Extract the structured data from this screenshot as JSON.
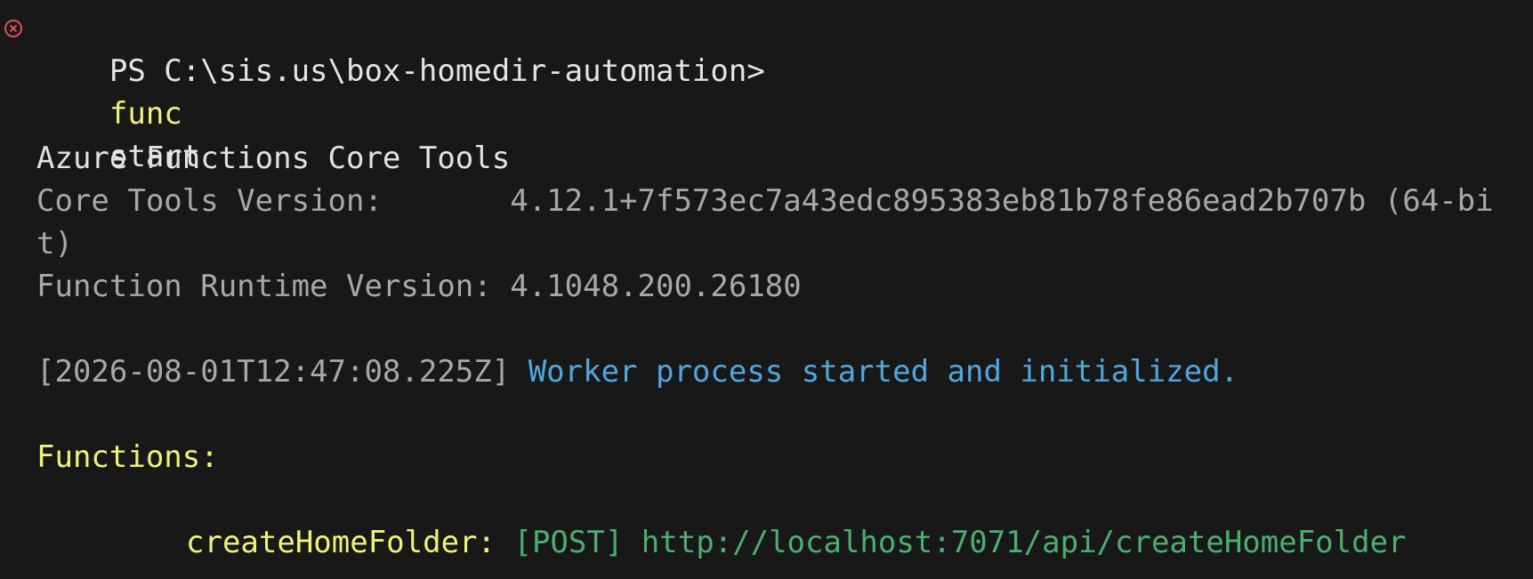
{
  "prompt": {
    "prefix": "PS C:\\sis.us\\box-homedir-automation>",
    "command": "func",
    "argument": "start",
    "status_icon": "error-circle-icon",
    "status_color": "#e05050"
  },
  "header": {
    "title": "Azure Functions Core Tools",
    "core_tools_label": "Core Tools Version:",
    "core_tools_value": "4.12.1+7f573ec7a43edc895383eb81b78fe86ead2b707b (64-bi",
    "core_tools_wrap": "t)",
    "runtime_label": "Function Runtime Version:",
    "runtime_value": "4.1048.200.26180"
  },
  "log": {
    "timestamp": "[2026-08-01T12:47:08.225Z]",
    "message": "Worker process started and initialized."
  },
  "functions": {
    "heading": "Functions:",
    "items": [
      {
        "name": "createHomeFolder:",
        "method": "[POST]",
        "url": "http://localhost:7071/api/createHomeFolder"
      }
    ]
  },
  "colors": {
    "background": "#181818",
    "yellow": "#f1f17a",
    "blue": "#4fa7dd",
    "green": "#4caf6e",
    "gray": "#a8a8a8"
  }
}
